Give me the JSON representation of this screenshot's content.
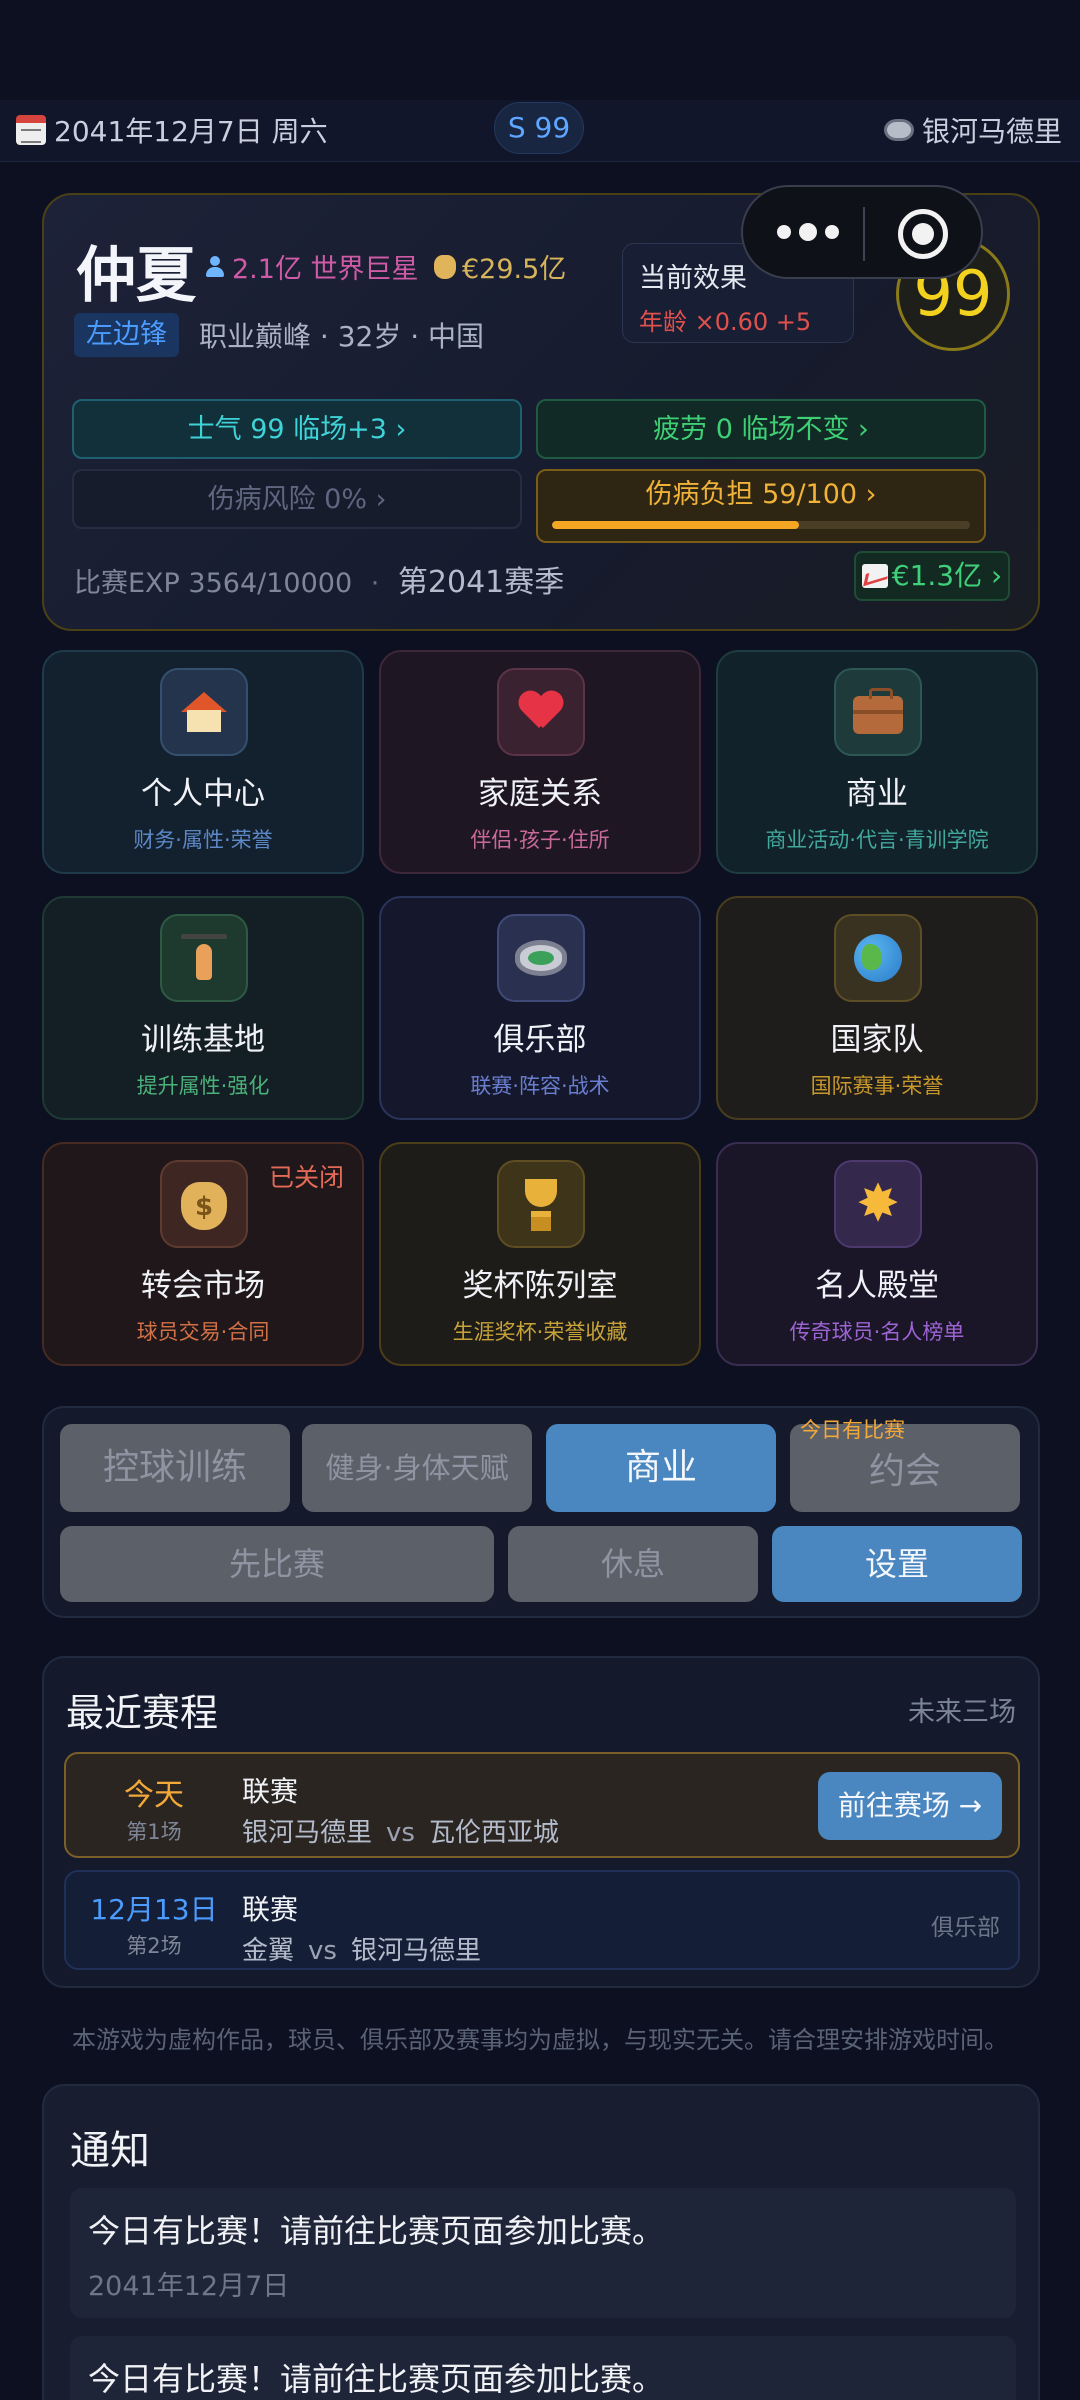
{
  "topbar": {
    "date": "2041年12月7日 周六",
    "season_badge": "S 99",
    "club": "银河马德里"
  },
  "player": {
    "name": "仲夏",
    "fans": "2.1亿 世界巨星",
    "net_worth": "€29.5亿",
    "position": "左边锋",
    "info": "职业巅峰 · 32岁 · 中国",
    "overall": "99",
    "effect": {
      "title": "当前效果",
      "arrow": "›",
      "value": "年龄 ×0.60  +5"
    },
    "stats": {
      "morale": "士气 99  临场+3 ›",
      "fatigue": "疲劳 0  临场不变 ›",
      "injury_risk": "伤病风险 0% ›",
      "injury_load": "伤病负担 59/100 ›",
      "injury_load_fraction": 0.59
    },
    "exp": "比赛EXP 3564/10000",
    "exp_sep": "·",
    "season": "第2041赛季",
    "market_value": "€1.3亿 ›"
  },
  "tiles": [
    {
      "title": "个人中心",
      "sub": "财务·属性·荣誉",
      "icon": "house-icon"
    },
    {
      "title": "家庭关系",
      "sub": "伴侣·孩子·住所",
      "icon": "heart-icon"
    },
    {
      "title": "商业",
      "sub": "商业活动·代言·青训学院",
      "icon": "briefcase-icon"
    },
    {
      "title": "训练基地",
      "sub": "提升属性·强化",
      "icon": "weightlifter-icon"
    },
    {
      "title": "俱乐部",
      "sub": "联赛·阵容·战术",
      "icon": "stadium-icon"
    },
    {
      "title": "国家队",
      "sub": "国际赛事·荣誉",
      "icon": "globe-icon"
    },
    {
      "title": "转会市场",
      "sub": "球员交易·合同",
      "icon": "money-bag-icon",
      "badge": "已关闭"
    },
    {
      "title": "奖杯陈列室",
      "sub": "生涯奖杯·荣誉收藏",
      "icon": "trophy-icon"
    },
    {
      "title": "名人殿堂",
      "sub": "传奇球员·名人榜单",
      "icon": "star-icon"
    }
  ],
  "actions": {
    "ball_training": "控球训练",
    "fitness": "健身·身体天赋",
    "business": "商业",
    "date": "约会",
    "date_hint": "今日有比赛",
    "match_first": "先比赛",
    "rest": "休息",
    "settings": "设置"
  },
  "schedule": {
    "title": "最近赛程",
    "more": "未来三场",
    "matches": [
      {
        "day": "今天",
        "no": "第1场",
        "competition": "联赛",
        "home": "银河马德里",
        "vs": "vs",
        "away": "瓦伦西亚城",
        "action": "前往赛场 →"
      },
      {
        "day": "12月13日",
        "no": "第2场",
        "competition": "联赛",
        "home": "金翼",
        "vs": "vs",
        "away": "银河马德里",
        "tag": "俱乐部"
      }
    ]
  },
  "disclaimer": "本游戏为虚构作品，球员、俱乐部及赛事均为虚拟，与现实无关。请合理安排游戏时间。",
  "notices": {
    "title": "通知",
    "items": [
      {
        "message": "今日有比赛！请前往比赛页面参加比赛。",
        "time": "2041年12月7日"
      },
      {
        "message": "今日有比赛！请前往比赛页面参加比赛。"
      }
    ]
  }
}
